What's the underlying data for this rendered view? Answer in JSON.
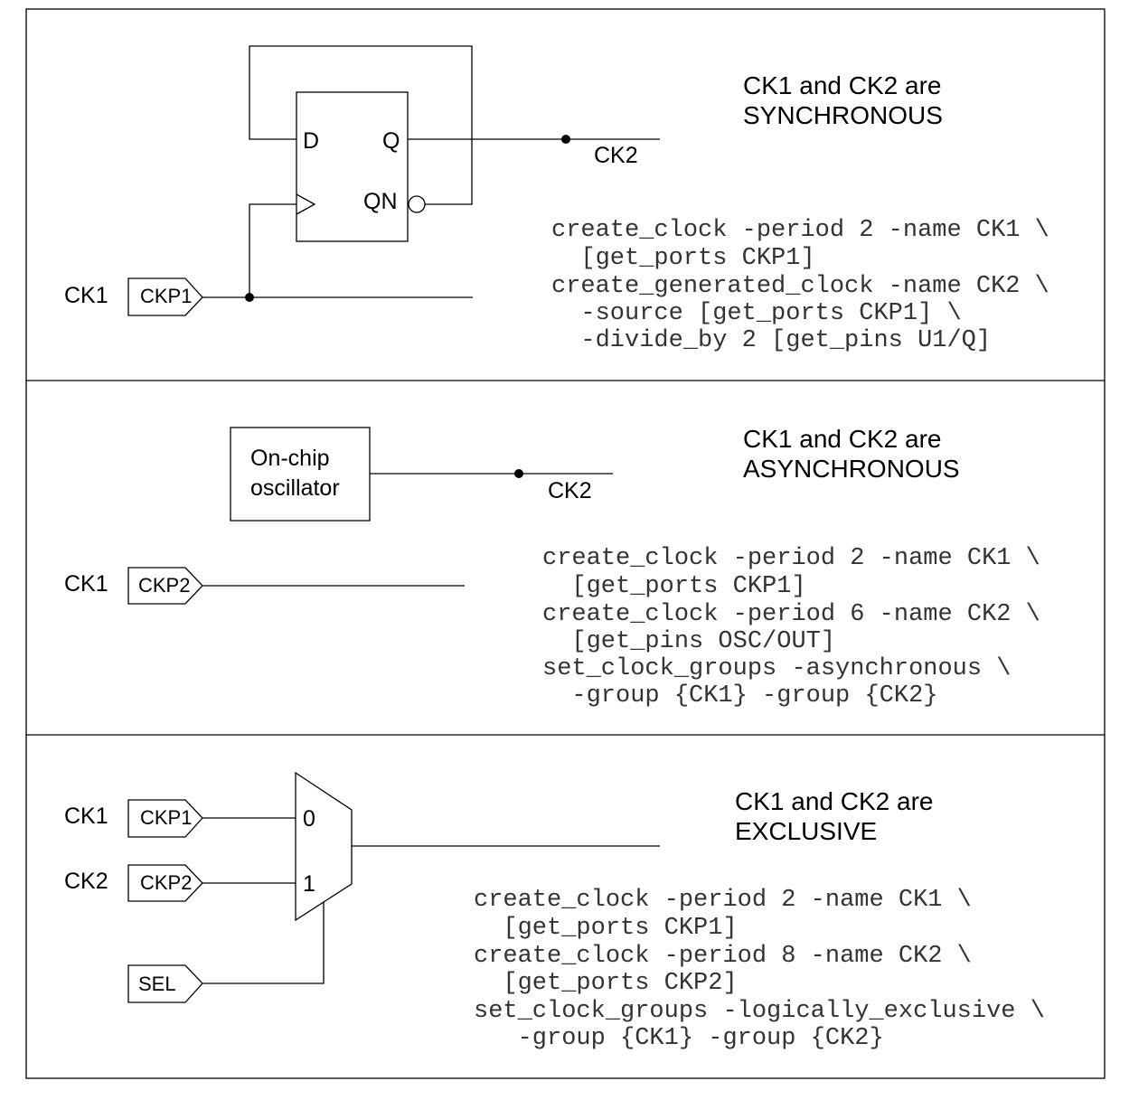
{
  "panels": [
    {
      "heading": [
        "CK1 and CK2 are",
        "SYNCHRONOUS"
      ],
      "labels": {
        "ck1": "CK1",
        "port": "CKP1",
        "d": "D",
        "q": "Q",
        "qn": "QN",
        "ck2": "CK2"
      },
      "code": [
        "create_clock -period 2 -name CK1 \\",
        "  [get_ports CKP1]",
        "create_generated_clock -name CK2 \\",
        "  -source [get_ports CKP1] \\",
        "  -divide_by 2 [get_pins U1/Q]"
      ]
    },
    {
      "heading": [
        "CK1 and CK2 are",
        "ASYNCHRONOUS"
      ],
      "labels": {
        "ck1": "CK1",
        "port": "CKP2",
        "osc1": "On-chip",
        "osc2": "oscillator",
        "ck2": "CK2"
      },
      "code": [
        "create_clock -period 2 -name CK1 \\",
        "  [get_ports CKP1]",
        "create_clock -period 6 -name CK2 \\",
        "  [get_pins OSC/OUT]",
        "set_clock_groups -asynchronous \\",
        "  -group {CK1} -group {CK2}"
      ]
    },
    {
      "heading": [
        "CK1 and CK2 are",
        "EXCLUSIVE"
      ],
      "labels": {
        "ck1": "CK1",
        "ck2": "CK2",
        "port1": "CKP1",
        "port2": "CKP2",
        "sel": "SEL",
        "in0": "0",
        "in1": "1"
      },
      "code": [
        "create_clock -period 2 -name CK1 \\",
        "  [get_ports CKP1]",
        "create_clock -period 8 -name CK2 \\",
        "  [get_ports CKP2]",
        "set_clock_groups -logically_exclusive \\",
        "   -group {CK1} -group {CK2}"
      ]
    }
  ]
}
